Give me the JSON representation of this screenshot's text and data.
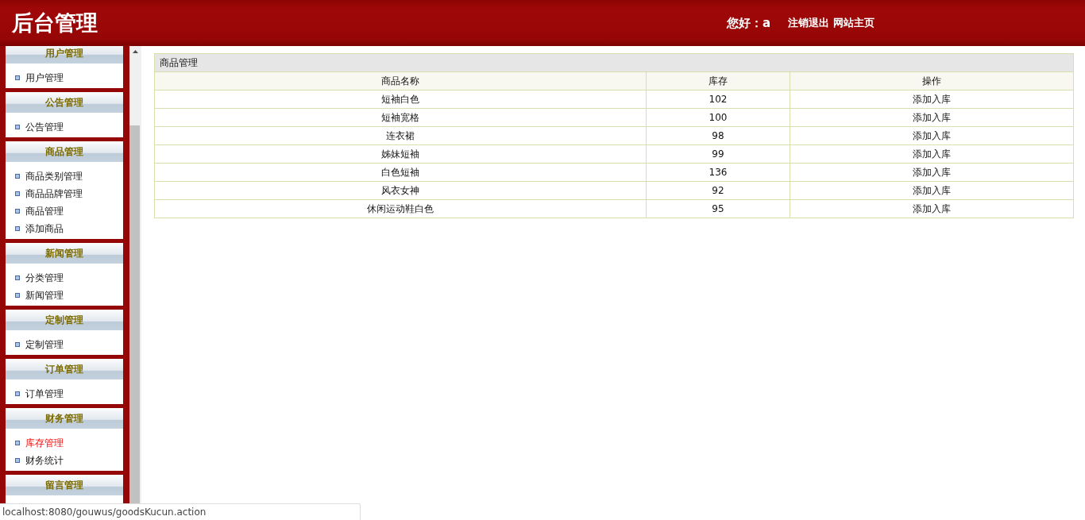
{
  "header": {
    "title": "后台管理",
    "greeting": "您好：a",
    "links": [
      "注销退出",
      "网站主页"
    ]
  },
  "sidebar": {
    "sections": [
      {
        "title": "用户管理",
        "items": [
          {
            "label": "用户管理",
            "selected": false
          }
        ]
      },
      {
        "title": "公告管理",
        "items": [
          {
            "label": "公告管理",
            "selected": false
          }
        ]
      },
      {
        "title": "商品管理",
        "items": [
          {
            "label": "商品类别管理",
            "selected": false
          },
          {
            "label": "商品品牌管理",
            "selected": false
          },
          {
            "label": "商品管理",
            "selected": false
          },
          {
            "label": "添加商品",
            "selected": false
          }
        ]
      },
      {
        "title": "新闻管理",
        "items": [
          {
            "label": "分类管理",
            "selected": false
          },
          {
            "label": "新闻管理",
            "selected": false
          }
        ]
      },
      {
        "title": "定制管理",
        "items": [
          {
            "label": "定制管理",
            "selected": false
          }
        ]
      },
      {
        "title": "订单管理",
        "items": [
          {
            "label": "订单管理",
            "selected": false
          }
        ]
      },
      {
        "title": "财务管理",
        "items": [
          {
            "label": "库存管理",
            "selected": true
          },
          {
            "label": "财务统计",
            "selected": false
          }
        ]
      },
      {
        "title": "留言管理"
      }
    ]
  },
  "table": {
    "title": "商品管理",
    "columns": [
      "商品名称",
      "库存",
      "操作"
    ],
    "rows": [
      [
        "短袖白色",
        "102",
        "添加入库"
      ],
      [
        "短袖宽格",
        "100",
        "添加入库"
      ],
      [
        "连衣裙",
        "98",
        "添加入库"
      ],
      [
        "姊妹短袖",
        "99",
        "添加入库"
      ],
      [
        "白色短袖",
        "136",
        "添加入库"
      ],
      [
        "风衣女神",
        "92",
        "添加入库"
      ],
      [
        "休闲运动鞋白色",
        "95",
        "添加入库"
      ]
    ]
  },
  "status_bar": {
    "url": "localhost:8080/gouwus/goodsKucun.action"
  }
}
